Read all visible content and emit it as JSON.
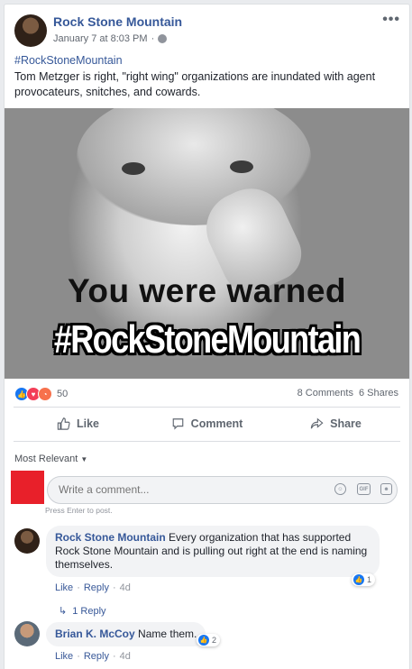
{
  "post": {
    "author": "Rock Stone Mountain",
    "timestamp": "January 7 at 8:03 PM",
    "more_icon": "more-dots-icon",
    "hashtag": "#RockStoneMountain",
    "text": "Tom Metzger is right, \"right wing\" organizations are inundated with agent provocateurs, snitches, and cowards.",
    "image": {
      "caption_line1": "You were warned",
      "caption_line2": "#RockStoneMountain"
    }
  },
  "stats": {
    "reaction_count": "50",
    "comments": "8 Comments",
    "shares": "6 Shares",
    "reaction_icons": [
      "like-reaction-icon",
      "love-reaction-icon",
      "angry-reaction-icon"
    ]
  },
  "actions": {
    "like": "Like",
    "comment": "Comment",
    "share": "Share"
  },
  "comments_section": {
    "sort_label": "Most Relevant",
    "input_placeholder": "Write a comment...",
    "press_enter_hint": "Press Enter to post.",
    "comments": [
      {
        "author": "Rock Stone Mountain",
        "text": "Every organization that has supported Rock Stone Mountain and is pulling out right at the end is naming themselves.",
        "like_count": "1",
        "like_label": "Like",
        "reply_label": "Reply",
        "time": "4d",
        "replies_link": "1 Reply"
      },
      {
        "author": "Brian K. McCoy",
        "text": "Name them.",
        "like_count": "2",
        "like_label": "Like",
        "reply_label": "Reply",
        "time": "4d"
      }
    ]
  },
  "colors": {
    "link_blue": "#365899",
    "like_blue": "#1877f2",
    "love_red": "#f33e58",
    "angry_orange": "#f7714c",
    "user_avatar_red": "#e8202a"
  }
}
